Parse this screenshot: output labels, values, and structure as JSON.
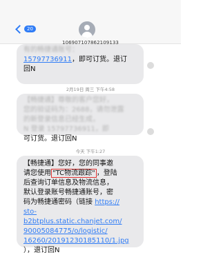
{
  "header": {
    "back_badge": "20",
    "sender_number": "10690710786210913​3"
  },
  "messages": [
    {
      "lines": [
        {
          "text": "有的畅捷通账号：",
          "style": "blur"
        },
        {
          "text": "15797736911",
          "style": "link",
          "suffix": "，即可订货。退订"
        },
        {
          "text": "回N",
          "style": "plain"
        }
      ]
    },
    {
      "lines": [
        {
          "text": "【畅捷通】尊敬的客户您好，",
          "style": "blur"
        },
        {
          "text": "您的验证码为：2688，请勿泄露",
          "style": "blur"
        },
        {
          "text": "的新登录信息已经生成，",
          "style": "blur"
        },
        {
          "text": "N 登录 15797736911，即",
          "style": "blur"
        },
        {
          "text": "可订货。退订回N",
          "style": "plain"
        }
      ]
    },
    {
      "lines": [
        {
          "text": "【畅捷通】您好，您的同事邀",
          "style": "plain"
        },
        {
          "text": "请您使用",
          "style": "plain",
          "highlight": "\"TC物流跟踪\"",
          "suffix": "，登陆"
        },
        {
          "text": "后查询订单信息及物流信息，",
          "style": "plain"
        },
        {
          "text": "默认登录账号畅捷通账号，密",
          "style": "plain"
        },
        {
          "text": "码为畅捷通密码（链接 ",
          "style": "plain",
          "linkpart": "https://"
        },
        {
          "text": "sto-",
          "style": "link"
        },
        {
          "text": "b2btplus.static.chanjet.com/",
          "style": "link"
        },
        {
          "text": "90005084775/o/logistic/",
          "style": "link"
        },
        {
          "text": "16260/20191230185110/1.jpg",
          "style": "link"
        },
        {
          "text": "），退订回N",
          "style": "plain"
        }
      ]
    }
  ],
  "timestamps": {
    "first": "2月19日 周三 下午4:58",
    "second": "今天 下午1:27"
  },
  "colors": {
    "accent": "#2f7cf6",
    "bubble": "#e9e9eb",
    "highlight_border": "#e0302f"
  }
}
